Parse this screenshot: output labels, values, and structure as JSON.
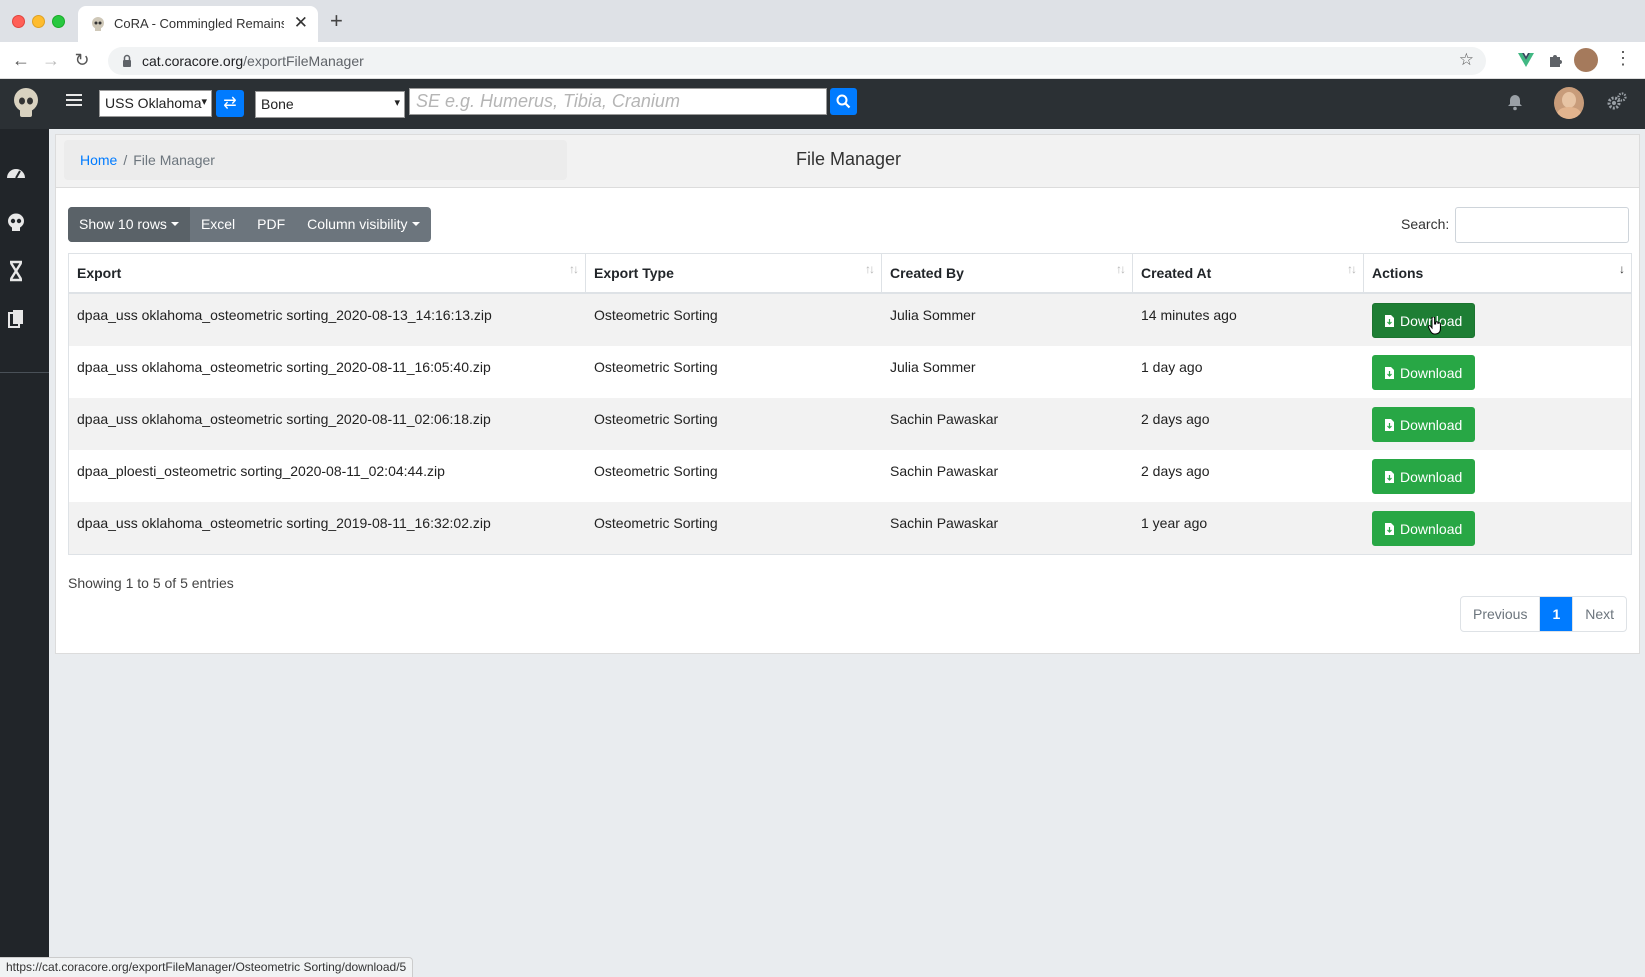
{
  "browser": {
    "tab_title": "CoRA - Commingled Remains A",
    "url_domain": "cat.coracore.org",
    "url_path": "/exportFileManager",
    "status_url": "https://cat.coracore.org/exportFileManager/Osteometric Sorting/download/5"
  },
  "header": {
    "project_select": "USS Oklahoma",
    "element_select": "Bone",
    "search_placeholder": "SE e.g. Humerus, Tibia, Cranium"
  },
  "breadcrumb": {
    "home": "Home",
    "separator": "/",
    "current": "File Manager"
  },
  "page_title": "File Manager",
  "toolbar": {
    "show_rows": "Show 10 rows",
    "excel": "Excel",
    "pdf": "PDF",
    "column_visibility": "Column visibility",
    "search_label": "Search:"
  },
  "table": {
    "columns": [
      "Export",
      "Export Type",
      "Created By",
      "Created At",
      "Actions"
    ],
    "rows": [
      {
        "export": "dpaa_uss oklahoma_osteometric sorting_2020-08-13_14:16:13.zip",
        "type": "Osteometric Sorting",
        "created_by": "Julia Sommer",
        "created_at": "14 minutes ago",
        "action": "Download"
      },
      {
        "export": "dpaa_uss oklahoma_osteometric sorting_2020-08-11_16:05:40.zip",
        "type": "Osteometric Sorting",
        "created_by": "Julia Sommer",
        "created_at": "1 day ago",
        "action": "Download"
      },
      {
        "export": "dpaa_uss oklahoma_osteometric sorting_2020-08-11_02:06:18.zip",
        "type": "Osteometric Sorting",
        "created_by": "Sachin Pawaskar",
        "created_at": "2 days ago",
        "action": "Download"
      },
      {
        "export": "dpaa_ploesti_osteometric sorting_2020-08-11_02:04:44.zip",
        "type": "Osteometric Sorting",
        "created_by": "Sachin Pawaskar",
        "created_at": "2 days ago",
        "action": "Download"
      },
      {
        "export": "dpaa_uss oklahoma_osteometric sorting_2019-08-11_16:32:02.zip",
        "type": "Osteometric Sorting",
        "created_by": "Sachin Pawaskar",
        "created_at": "1 year ago",
        "action": "Download"
      }
    ]
  },
  "footer": {
    "info": "Showing 1 to 5 of 5 entries",
    "previous": "Previous",
    "page": "1",
    "next": "Next"
  },
  "colors": {
    "accent": "#007bff",
    "download": "#28a745",
    "appbar": "#2b3034",
    "sidebar": "#212529"
  }
}
